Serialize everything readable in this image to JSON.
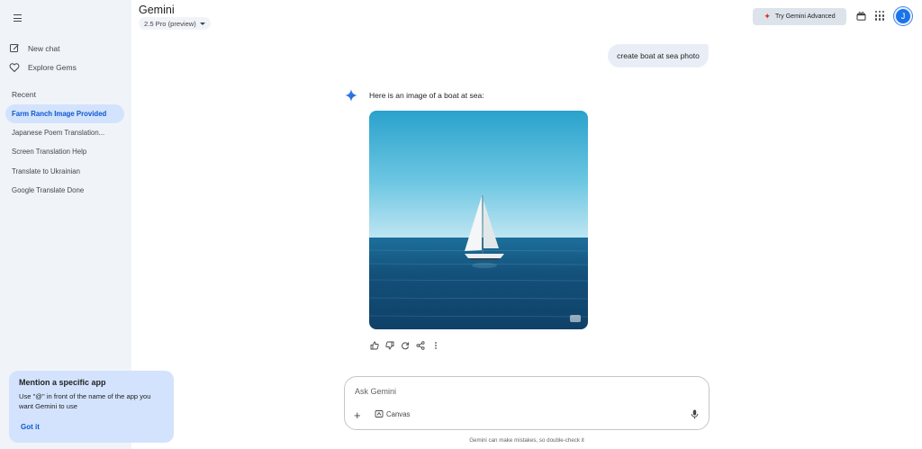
{
  "header": {
    "app_title": "Gemini",
    "model": "2.5 Pro (preview)",
    "advanced_label": "Try Gemini Advanced",
    "avatar_initial": "J"
  },
  "sidebar": {
    "new_chat": "New chat",
    "explore_gems": "Explore Gems",
    "recent_label": "Recent",
    "recent_items": [
      {
        "label": "Farm Ranch Image Provided",
        "active": true
      },
      {
        "label": "Japanese Poem Translation..."
      },
      {
        "label": "Screen Translation Help"
      },
      {
        "label": "Translate to Ukrainian"
      },
      {
        "label": "Google Translate Done"
      }
    ],
    "tip": {
      "title": "Mention a specific app",
      "text": "Use \"@\" in front of the name of the app you want Gemini to use",
      "button": "Got it"
    }
  },
  "chat": {
    "user_message": "create boat at sea photo",
    "reply_text": "Here is an image of a boat at sea:"
  },
  "input": {
    "placeholder": "Ask Gemini",
    "canvas_label": "Canvas",
    "disclaimer": "Gemini can make mistakes, so double-check it"
  },
  "colors": {
    "sidebar_bg": "#f0f4f9",
    "active_bg": "#d3e3fd",
    "accent": "#0b57d0"
  }
}
